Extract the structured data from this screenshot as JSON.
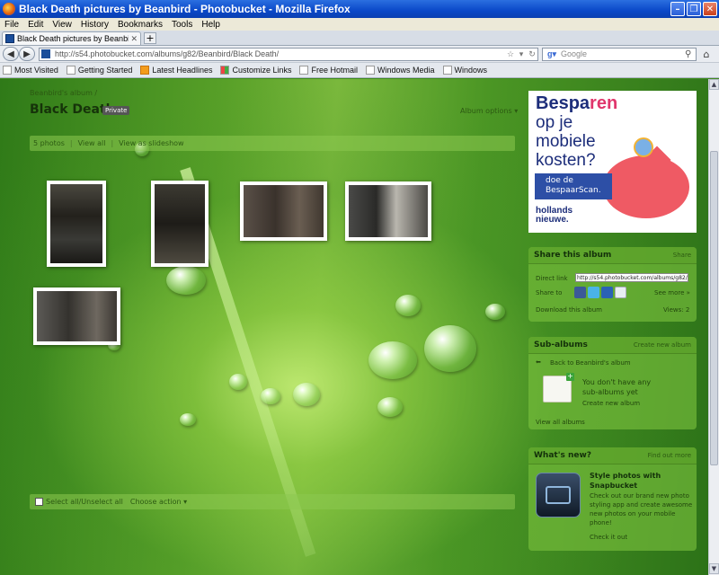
{
  "window": {
    "title": "Black Death pictures by Beanbird - Photobucket - Mozilla Firefox"
  },
  "menu": [
    "File",
    "Edit",
    "View",
    "History",
    "Bookmarks",
    "Tools",
    "Help"
  ],
  "tab": {
    "label": "Black Death pictures by Beanbird - P..."
  },
  "nav": {
    "url": "http://s54.photobucket.com/albums/g82/Beanbird/Black Death/",
    "search_placeholder": "Google"
  },
  "bookmarks": [
    "Most Visited",
    "Getting Started",
    "Latest Headlines",
    "Customize Links",
    "Free Hotmail",
    "Windows Media",
    "Windows"
  ],
  "album": {
    "breadcrumb": "Beanbird's album /",
    "title": "Black Death",
    "privacy": "Private",
    "options": "Album options ▾",
    "count": "5 photos",
    "view_all": "View all",
    "slideshow": "View as slideshow",
    "select_all": "Select all/Unselect all",
    "choose_action": "Choose action ▾"
  },
  "ad": {
    "line1_a": "Bespa",
    "line1_b": "ren",
    "line2": "op je",
    "line3": "mobiele",
    "line4": "kosten?",
    "button": "doe de BespaarScan.",
    "brand1": "hollands",
    "brand2": "nieuwe."
  },
  "share": {
    "title": "Share this album",
    "share_link": "Share",
    "direct_label": "Direct link",
    "direct_value": "http://s54.photobucket.com/albums/g82/Be",
    "share_to": "Share to",
    "see_more": "See more »",
    "download": "Download this album",
    "views": "Views: 2"
  },
  "subalbums": {
    "title": "Sub-albums",
    "create_link": "Create new album",
    "back": "Back to Beanbird's album",
    "empty1": "You don't have any",
    "empty2": "sub-albums yet",
    "create": "Create new album",
    "view_all": "View all albums"
  },
  "whatsnew": {
    "title": "What's new?",
    "find_out": "Find out more",
    "heading1": "Style photos with",
    "heading2": "Snapbucket",
    "body1": "Check out our brand new photo",
    "body2": "styling app and create awesome",
    "body3": "new photos on your mobile",
    "body4": "phone!",
    "cta": "Check it out"
  },
  "colors": {
    "leaf_green": "#58a028",
    "panel_green": "#78be3c",
    "ad_blue": "#1c2d7a",
    "ad_pink": "#e0366c"
  }
}
